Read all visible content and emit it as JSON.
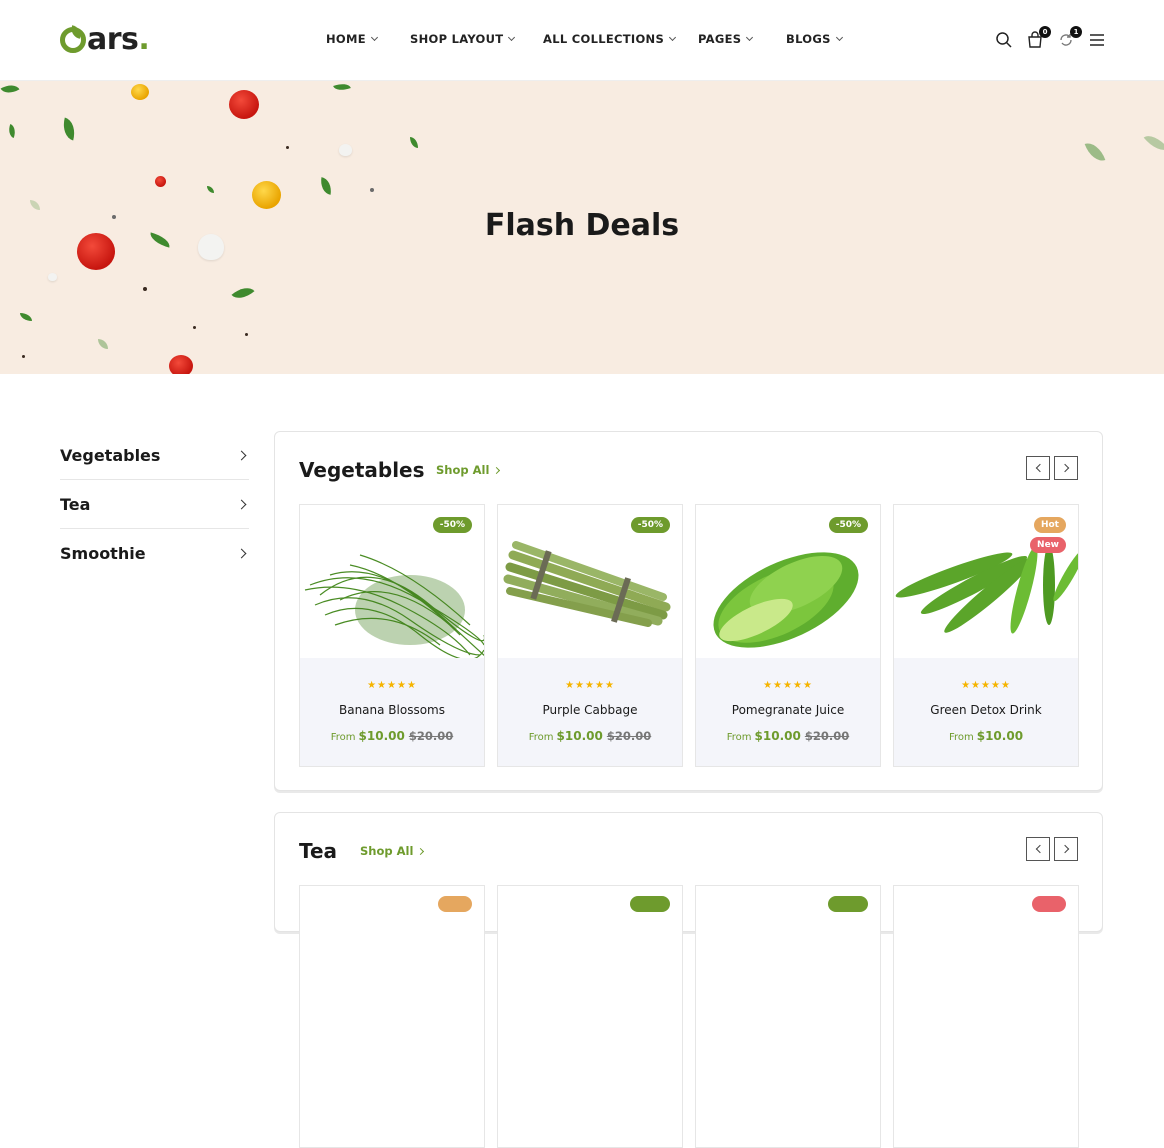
{
  "logo": {
    "text": "ars",
    "dot": "."
  },
  "nav": [
    {
      "label": "HOME"
    },
    {
      "label": "SHOP LAYOUT"
    },
    {
      "label": "ALL COLLECTIONS"
    },
    {
      "label": "PAGES"
    },
    {
      "label": "BLOGS"
    }
  ],
  "header_icons": {
    "search": "search-icon",
    "cart": {
      "icon": "cart-icon",
      "count": "0"
    },
    "compare": {
      "icon": "compare-icon",
      "count": "1"
    },
    "menu": "menu-icon"
  },
  "hero": {
    "title": "Flash Deals"
  },
  "categories": [
    {
      "label": "Vegetables"
    },
    {
      "label": "Tea"
    },
    {
      "label": "Smoothie"
    }
  ],
  "sections": [
    {
      "title": "Vegetables",
      "shop_all": "Shop All",
      "products": [
        {
          "name": "Banana Blossoms",
          "from": "From",
          "price": "$10.00",
          "old_price": "$20.00",
          "badges": [
            "-50%"
          ],
          "rating": "★★★★★"
        },
        {
          "name": "Purple Cabbage",
          "from": "From",
          "price": "$10.00",
          "old_price": "$20.00",
          "badges": [
            "-50%"
          ],
          "rating": "★★★★★"
        },
        {
          "name": "Pomegranate Juice",
          "from": "From",
          "price": "$10.00",
          "old_price": "$20.00",
          "badges": [
            "-50%"
          ],
          "rating": "★★★★★"
        },
        {
          "name": "Green Detox Drink",
          "from": "From",
          "price": "$10.00",
          "old_price": "",
          "badges": [
            "Hot",
            "New"
          ],
          "rating": "★★★★★"
        }
      ]
    },
    {
      "title": "Tea",
      "shop_all": "Shop All",
      "products": []
    }
  ],
  "colors": {
    "accent": "#6e9b2d",
    "hero_bg": "#f8ece1",
    "hot": "#e5a75f",
    "new": "#e9626a",
    "card_info_bg": "#f4f5fa"
  }
}
